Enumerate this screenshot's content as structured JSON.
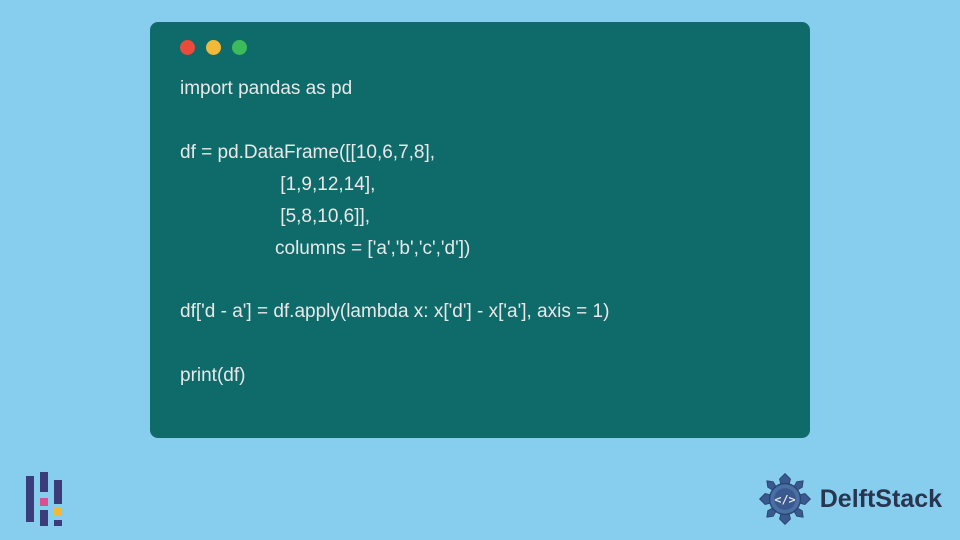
{
  "code": {
    "lines": "import pandas as pd\n\ndf = pd.DataFrame([[10,6,7,8],\n                   [1,9,12,14],\n                   [5,8,10,6]],\n                  columns = ['a','b','c','d'])\n\ndf['d - a'] = df.apply(lambda x: x['d'] - x['a'], axis = 1)\n\nprint(df)"
  },
  "brand": {
    "name": "DelftStack"
  }
}
